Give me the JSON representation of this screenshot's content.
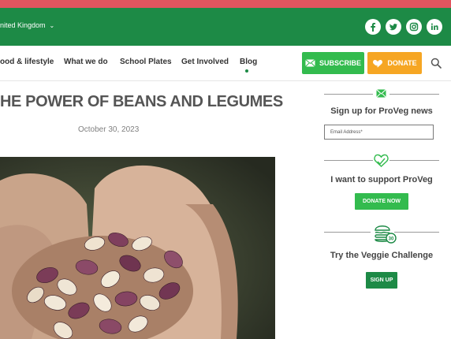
{
  "header": {
    "region": "nited Kingdom",
    "social": [
      "facebook-icon",
      "twitter-icon",
      "instagram-icon",
      "linkedin-icon"
    ]
  },
  "nav": {
    "items": [
      "ood & lifestyle",
      "What we do",
      "School Plates",
      "Get Involved",
      "Blog"
    ],
    "active": "Blog",
    "subscribe_label": "SUBSCRIBE",
    "donate_label": "DONATE"
  },
  "article": {
    "title": "HE POWER OF BEANS AND LEGUMES",
    "date": "October 30, 2023"
  },
  "sidebar": {
    "news": {
      "title": "Sign up for ProVeg news",
      "email_placeholder": "Email Address*"
    },
    "support": {
      "title": "I want to support ProVeg",
      "button": "DONATE NOW"
    },
    "challenge": {
      "title": "Try the Veggie Challenge",
      "button": "SIGN UP"
    }
  },
  "colors": {
    "brand_green": "#1d8a46",
    "accent_green": "#33bb4e",
    "donate_orange": "#f6a623",
    "top_strip": "#e2555f"
  }
}
